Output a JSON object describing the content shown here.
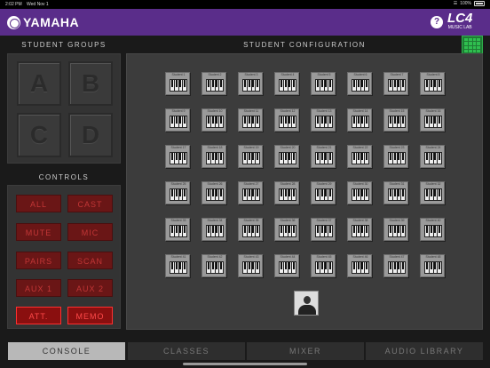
{
  "status_bar": {
    "time": "2:02 PM",
    "date": "Wed Nov 1",
    "battery": "100%"
  },
  "header": {
    "logo_text": "YAMAHA",
    "help_label": "?",
    "product": "LC4",
    "product_sub": "MUSIC LAB"
  },
  "student_groups": {
    "title": "STUDENT GROUPS",
    "groups": [
      "A",
      "B",
      "C",
      "D"
    ]
  },
  "controls": {
    "title": "CONTROLS",
    "buttons": [
      "ALL",
      "CAST",
      "MUTE",
      "MIC",
      "PAIRS",
      "SCAN",
      "AUX 1",
      "AUX 2",
      "ATT.",
      "MEMO"
    ]
  },
  "student_config": {
    "title": "STUDENT CONFIGURATION",
    "students": [
      "Student 1",
      "Student 2",
      "Student 3",
      "Student 4",
      "Student 5",
      "Student 6",
      "Student 7",
      "Student 8",
      "Student 9",
      "Student 10",
      "Student 11",
      "Student 12",
      "Student 13",
      "Student 14",
      "Student 15",
      "Student 16",
      "Student 17",
      "Student 18",
      "Student 19",
      "Student 20",
      "Student 21",
      "Student 22",
      "Student 23",
      "Student 24",
      "Student 25",
      "Student 26",
      "Student 27",
      "Student 28",
      "Student 29",
      "Student 30",
      "Student 31",
      "Student 32",
      "Student 33",
      "Student 34",
      "Student 35",
      "Student 36",
      "Student 37",
      "Student 38",
      "Student 39",
      "Student 40",
      "Student 41",
      "Student 42",
      "Student 43",
      "Student 44",
      "Student 45",
      "Student 46",
      "Student 47",
      "Student 48"
    ]
  },
  "tabs": [
    "CONSOLE",
    "CLASSES",
    "MIXER",
    "AUDIO LIBRARY"
  ],
  "active_tab": "CONSOLE",
  "colors": {
    "header": "#5a2d8a",
    "control_button": "#6a1616",
    "control_button_active": "#8a0f0f",
    "grid_button": "#1f7a34"
  }
}
